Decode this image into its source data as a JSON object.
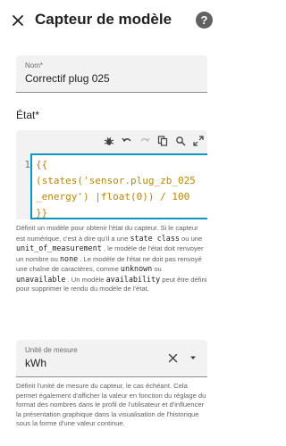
{
  "header": {
    "title": "Capteur de modèle",
    "help_glyph": "?"
  },
  "name_field": {
    "label": "Nom*",
    "value": "Correctif plug 025"
  },
  "state": {
    "label": "État*",
    "line_number": "1",
    "code_lines": [
      "{{",
      "(states('sensor.plug_zb_025",
      "_energy') |float(0)) / 100",
      "}}"
    ],
    "help": {
      "p1": "Définit un modèle pour obtenir l'état du capteur. Si le capteur est numérique, c'est à dire qu'il a une ",
      "code1": "state class",
      "p2": " ou une ",
      "code2": "unit_of_measurement",
      "p3": " , le modèle de l'état doit renvoyer un nombre ou ",
      "code3": "none",
      "p4": " . Le modèle de l'état ne doit pas renvoyé une chaîne de caractères, comme ",
      "code4": "unknown",
      "p5": " ou ",
      "code5": "unavailable",
      "p6": " . Un modèle ",
      "code6": "availability",
      "p7": " peut être défini pour supprimer le rendu du modèle de l'état."
    }
  },
  "unit_field": {
    "label": "Unité de mesure",
    "value": "kWh",
    "help": "Définit l'unité de mesure du capteur, le cas échéant. Cela permet également d'afficher la valeur en fonction du réglage du format des nombres dans le profil de l'utilisateur et d'influencer la présentation graphique dans la visualisation de l'historique sous la forme d'une valeur continue."
  },
  "icons": {
    "close": "close-icon",
    "help": "help-circle-icon",
    "toolbar": [
      "bug-icon",
      "undo-icon",
      "redo-icon",
      "copy-icon",
      "search-replace-icon",
      "fullscreen-icon"
    ],
    "clear": "clear-icon",
    "dropdown": "menu-down-icon"
  },
  "colors": {
    "focus_border": "#0a95c4",
    "field_bg": "#f2f2f2",
    "help_text": "#616161"
  }
}
